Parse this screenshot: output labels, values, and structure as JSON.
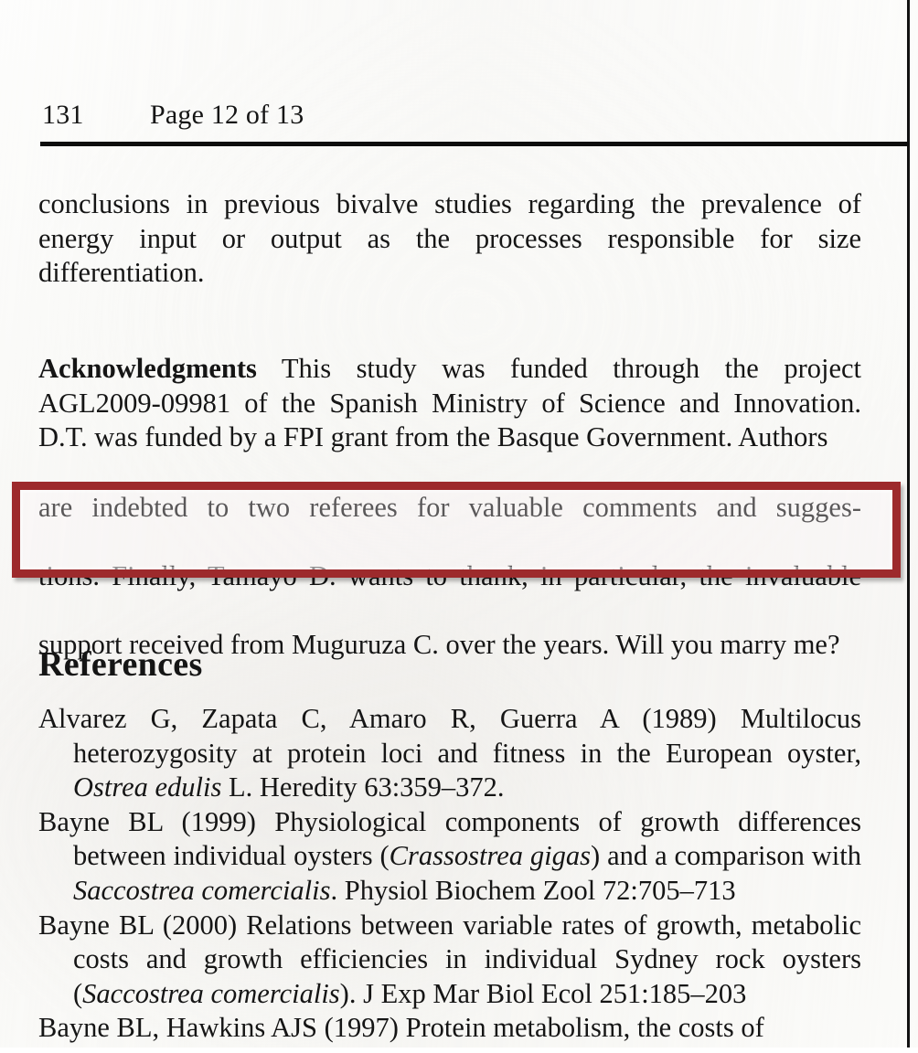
{
  "page": {
    "running_head": {
      "folio": "131",
      "page_label": "Page 12 of 13"
    }
  },
  "body": {
    "paragraph_conclusions": "conclusions in previous bivalve studies regarding the prevalence of energy input or output as the processes responsible for size differentiation.",
    "acknowledgments": {
      "label": "Acknowledgments",
      "text_head": "This study was funded through the project AGL2009-09981 of the Spanish Ministry of Science and Innovation. D.T. was funded by a FPI grant from the Basque Government. Authors",
      "line_partially_covered": "are indebted to two referees for valuable comments and sugges-",
      "highlighted_line_1": "tions. Finally, Tamayo D. wants to thank, in particular, the invaluable",
      "highlighted_line_2": "support received from Muguruza C. over the years. Will you marry me?"
    }
  },
  "annotation": {
    "box_color": "#9d2a2c",
    "box_label": "red-highlight-rectangle"
  },
  "references": {
    "heading": "References",
    "entries": [
      {
        "pre": "Alvarez G, Zapata C, Amaro R, Guerra A (1989) Multilocus heterozygosity at protein loci and fitness in the European oyster, ",
        "species": "Ostrea edulis",
        "post": " L. Heredity 63:359–372."
      },
      {
        "pre": "Bayne BL (1999) Physiological components of growth differences between individual oysters (",
        "species": "Crassostrea gigas",
        "mid": ") and a comparison with ",
        "species2": "Saccostrea comercialis",
        "post": ". Physiol Biochem Zool 72:705–713"
      },
      {
        "pre": "Bayne BL (2000) Relations between variable rates of growth, metabolic costs and growth efficiencies in individual Sydney rock oysters (",
        "species": "Saccostrea comercialis",
        "post": "). J Exp Mar Biol Ecol 251:185–203"
      },
      {
        "pre": "Bayne BL, Hawkins AJS (1997) Protein metabolism, the costs of",
        "species": "",
        "post": ""
      }
    ]
  }
}
